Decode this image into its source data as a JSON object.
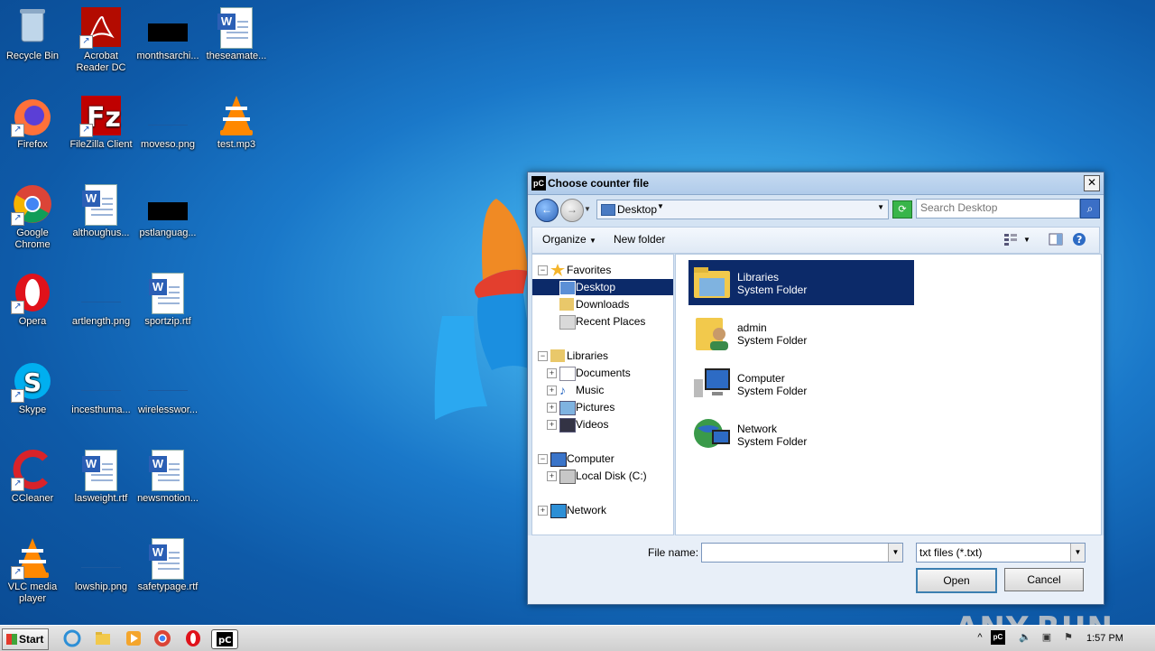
{
  "desktop": {
    "icons": [
      {
        "label": "Recycle Bin",
        "icon": "recycle-bin-icon"
      },
      {
        "label": "Acrobat Reader DC",
        "icon": "acrobat-icon"
      },
      {
        "label": "monthsarchi...",
        "icon": "black-file-icon"
      },
      {
        "label": "theseamate...",
        "icon": "word-doc-icon"
      },
      {
        "label": "Firefox",
        "icon": "firefox-icon"
      },
      {
        "label": "FileZilla Client",
        "icon": "filezilla-icon"
      },
      {
        "label": "moveso.png",
        "icon": "png-file-icon"
      },
      {
        "label": "test.mp3",
        "icon": "vlc-icon"
      },
      {
        "label": "Google Chrome",
        "icon": "chrome-icon"
      },
      {
        "label": "althoughus...",
        "icon": "word-doc-icon"
      },
      {
        "label": "pstlanguag...",
        "icon": "black-file-icon"
      },
      {
        "label": "Opera",
        "icon": "opera-icon"
      },
      {
        "label": "artlength.png",
        "icon": "png-file-icon"
      },
      {
        "label": "sportzip.rtf",
        "icon": "word-doc-icon"
      },
      {
        "label": "Skype",
        "icon": "skype-icon"
      },
      {
        "label": "incesthuma...",
        "icon": "png-file-icon"
      },
      {
        "label": "wirelesswor...",
        "icon": "png-file-icon"
      },
      {
        "label": "CCleaner",
        "icon": "ccleaner-icon"
      },
      {
        "label": "lasweight.rtf",
        "icon": "word-doc-icon"
      },
      {
        "label": "newsmotion...",
        "icon": "word-doc-icon"
      },
      {
        "label": "VLC media player",
        "icon": "vlc-icon"
      },
      {
        "label": "lowship.png",
        "icon": "png-file-icon"
      },
      {
        "label": "safetypage.rtf",
        "icon": "word-doc-icon"
      }
    ]
  },
  "dialog": {
    "title": "Choose counter file",
    "close": "✕",
    "address": {
      "location": "Desktop"
    },
    "search": {
      "placeholder": "Search Desktop"
    },
    "toolbar": {
      "organize": "Organize",
      "new_folder": "New folder"
    },
    "nav": {
      "favorites": "Favorites",
      "favorites_items": [
        "Desktop",
        "Downloads",
        "Recent Places"
      ],
      "libraries": "Libraries",
      "libraries_items": [
        "Documents",
        "Music",
        "Pictures",
        "Videos"
      ],
      "computer": "Computer",
      "computer_items": [
        "Local Disk (C:)"
      ],
      "network": "Network"
    },
    "files": [
      {
        "name": "Libraries",
        "type": "System Folder",
        "icon": "libraries-icon"
      },
      {
        "name": "admin",
        "type": "System Folder",
        "icon": "user-folder-icon"
      },
      {
        "name": "Computer",
        "type": "System Folder",
        "icon": "computer-icon"
      },
      {
        "name": "Network",
        "type": "System Folder",
        "icon": "network-icon"
      }
    ],
    "file_name_label": "File name:",
    "file_name_value": "",
    "filter": "txt files (*.txt)",
    "open": "Open",
    "cancel": "Cancel"
  },
  "watermark": "ANY.RUN",
  "taskbar": {
    "start": "Start",
    "clock": "1:57 PM"
  }
}
